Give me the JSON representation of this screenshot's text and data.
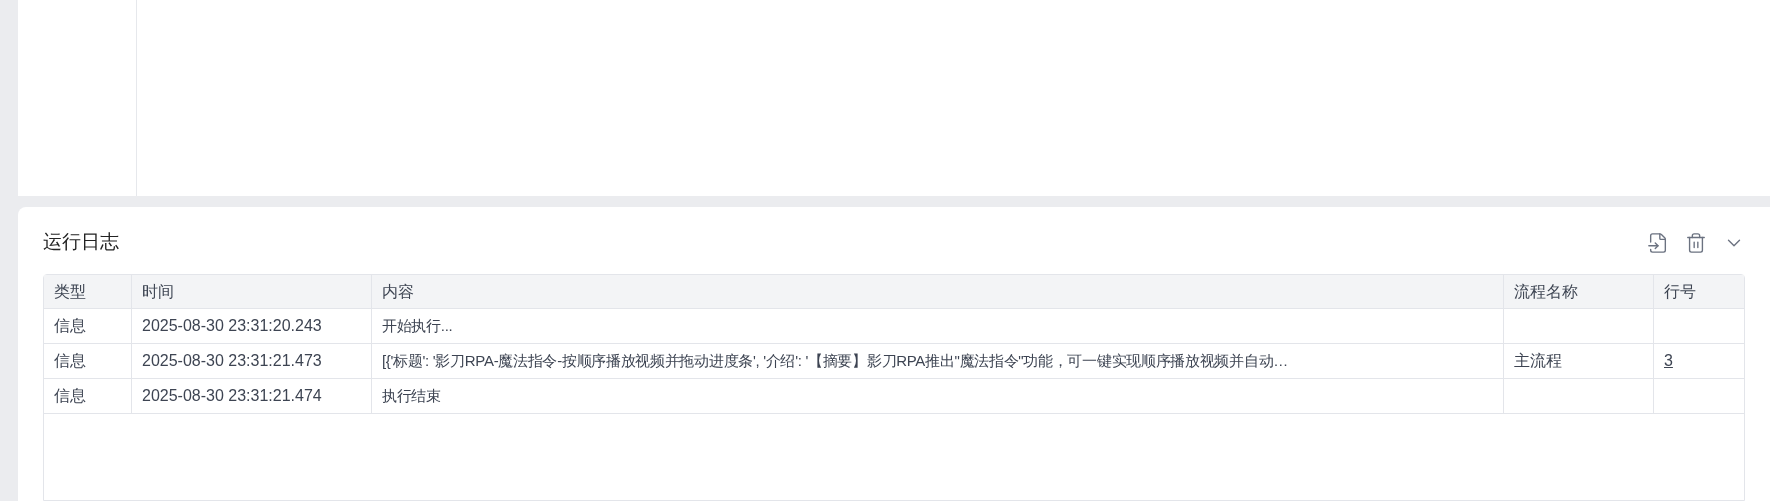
{
  "log_panel": {
    "title": "运行日志",
    "table": {
      "columns": [
        "类型",
        "时间",
        "内容",
        "流程名称",
        "行号"
      ],
      "rows": [
        {
          "type": "信息",
          "time": "2025-08-30 23:31:20.243",
          "content": "开始执行...",
          "process": "",
          "line": ""
        },
        {
          "type": "信息",
          "time": "2025-08-30 23:31:21.473",
          "content": "[{'标题': '影刀RPA-魔法指令-按顺序播放视频并拖动进度条', '介绍': '【摘要】影刀RPA推出\"魔法指令\"功能，可一键实现顺序播放视频并自动…",
          "process": "主流程",
          "line": "3"
        },
        {
          "type": "信息",
          "time": "2025-08-30 23:31:21.474",
          "content": "执行结束",
          "process": "",
          "line": ""
        }
      ]
    }
  }
}
